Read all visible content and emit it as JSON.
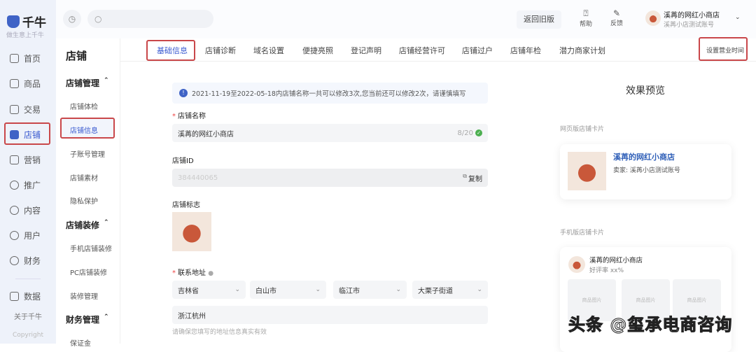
{
  "app": {
    "logo": "千牛",
    "slogan": "做生意上千牛"
  },
  "rail": {
    "items": [
      {
        "label": "首页"
      },
      {
        "label": "商品"
      },
      {
        "label": "交易"
      },
      {
        "label": "店铺"
      },
      {
        "label": "营销"
      },
      {
        "label": "推广"
      },
      {
        "label": "内容"
      },
      {
        "label": "用户"
      },
      {
        "label": "财务"
      },
      {
        "label": "数据"
      }
    ],
    "about": "关于千牛",
    "copyright": "Copyright"
  },
  "topbar": {
    "back_old": "返回旧版",
    "help": "帮助",
    "feedback": "反馈",
    "shop_name": "溪苒的网红小商店",
    "account": "溪苒小店测试账号"
  },
  "nav2": {
    "title": "店铺",
    "groups": [
      {
        "label": "店铺管理",
        "items": [
          "店铺体检",
          "店铺信息",
          "子账号管理",
          "店铺素材",
          "隐私保护"
        ]
      },
      {
        "label": "店铺装修",
        "items": [
          "手机店铺装修",
          "PC店铺装修",
          "装修管理"
        ]
      },
      {
        "label": "财务管理",
        "items": [
          "保证金"
        ]
      }
    ]
  },
  "tabs": [
    "基础信息",
    "店铺诊断",
    "域名设置",
    "便捷亮照",
    "登记声明",
    "店铺经营许可",
    "店铺过户",
    "店铺年检",
    "潜力商家计划"
  ],
  "set_hours": "设置营业时间",
  "form": {
    "notice": "2021-11-19至2022-05-18内店铺名称一共可以修改3次,您当前还可以修改2次，请谨慎填写",
    "name_label": "店铺名称",
    "name_value": "溪苒的网红小商店",
    "name_count": "8/20",
    "id_label": "店铺ID",
    "id_value": "384440065",
    "copy": "复制",
    "logo_label": "店铺标志",
    "address_label": "联系地址",
    "province": "吉林省",
    "city": "白山市",
    "district": "临江市",
    "street": "大栗子街道",
    "address_detail": "浙江杭州",
    "address_hint": "请确保您填写的地址信息真实有效"
  },
  "preview": {
    "title": "效果预览",
    "web_label": "网页版店铺卡片",
    "web_shop": "溪苒的网红小商店",
    "web_seller": "卖家: 溪苒小店测试账号",
    "mobile_label": "手机版店铺卡片",
    "mobile_shop": "溪苒的网红小商店",
    "rating": "好评率 xx%",
    "placeholder": "商品图片"
  },
  "watermark": "头条 @玺承电商咨询"
}
